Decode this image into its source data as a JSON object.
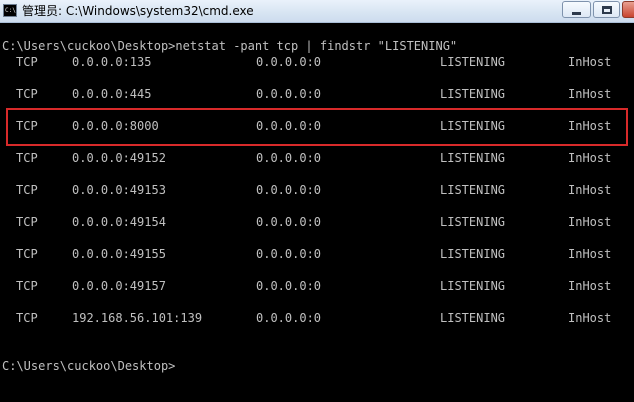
{
  "window": {
    "title": "管理员: C:\\Windows\\system32\\cmd.exe",
    "icon_text": "C:\\"
  },
  "console": {
    "command_line": "C:\\Users\\cuckoo\\Desktop>netstat -pant tcp | findstr \"LISTENING\"",
    "rows": [
      {
        "proto": "TCP",
        "local": "0.0.0.0:135",
        "foreign": "0.0.0.0:0",
        "state": "LISTENING",
        "offload": "InHost"
      },
      {
        "proto": "TCP",
        "local": "0.0.0.0:445",
        "foreign": "0.0.0.0:0",
        "state": "LISTENING",
        "offload": "InHost"
      },
      {
        "proto": "TCP",
        "local": "0.0.0.0:8000",
        "foreign": "0.0.0.0:0",
        "state": "LISTENING",
        "offload": "InHost"
      },
      {
        "proto": "TCP",
        "local": "0.0.0.0:49152",
        "foreign": "0.0.0.0:0",
        "state": "LISTENING",
        "offload": "InHost"
      },
      {
        "proto": "TCP",
        "local": "0.0.0.0:49153",
        "foreign": "0.0.0.0:0",
        "state": "LISTENING",
        "offload": "InHost"
      },
      {
        "proto": "TCP",
        "local": "0.0.0.0:49154",
        "foreign": "0.0.0.0:0",
        "state": "LISTENING",
        "offload": "InHost"
      },
      {
        "proto": "TCP",
        "local": "0.0.0.0:49155",
        "foreign": "0.0.0.0:0",
        "state": "LISTENING",
        "offload": "InHost"
      },
      {
        "proto": "TCP",
        "local": "0.0.0.0:49157",
        "foreign": "0.0.0.0:0",
        "state": "LISTENING",
        "offload": "InHost"
      },
      {
        "proto": "TCP",
        "local": "192.168.56.101:139",
        "foreign": "0.0.0.0:0",
        "state": "LISTENING",
        "offload": "InHost"
      }
    ],
    "prompt": "C:\\Users\\cuckoo\\Desktop>"
  },
  "colors": {
    "console_bg": "#000000",
    "console_text": "#c0c0c0",
    "highlight_border": "#d82a2a"
  }
}
